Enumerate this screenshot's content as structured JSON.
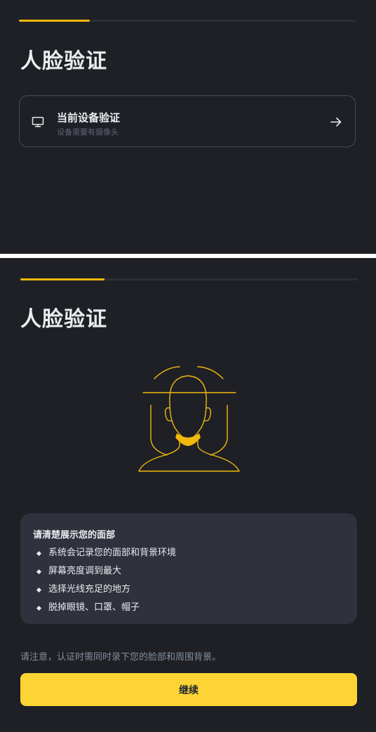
{
  "colors": {
    "background": "#1e2026",
    "accent": "#f0b90b",
    "button": "#fcd535",
    "card_border": "#474d57",
    "tips_background": "#2f313c",
    "muted_text": "#848e9c"
  },
  "screen_method": {
    "progress_fraction": 0.21,
    "title": "人脸验证",
    "options": [
      {
        "icon": "monitor-icon",
        "title": "当前设备验证",
        "subtitle": "设备需要有摄像头",
        "action_icon": "arrow-right-icon"
      }
    ]
  },
  "screen_instructions": {
    "progress_fraction": 0.25,
    "title": "人脸验证",
    "illustration_icon": "face-scan-icon",
    "tips": {
      "title": "请清楚展示您的面部",
      "items": [
        "系统会记录您的面部和背景环境",
        "屏幕亮度调到最大",
        "选择光线充足的地方",
        "脱掉眼镜、口罩、帽子"
      ]
    },
    "notice": "请注意，认证时需同时录下您的脸部和周围背景。",
    "continue_label": "继续"
  }
}
